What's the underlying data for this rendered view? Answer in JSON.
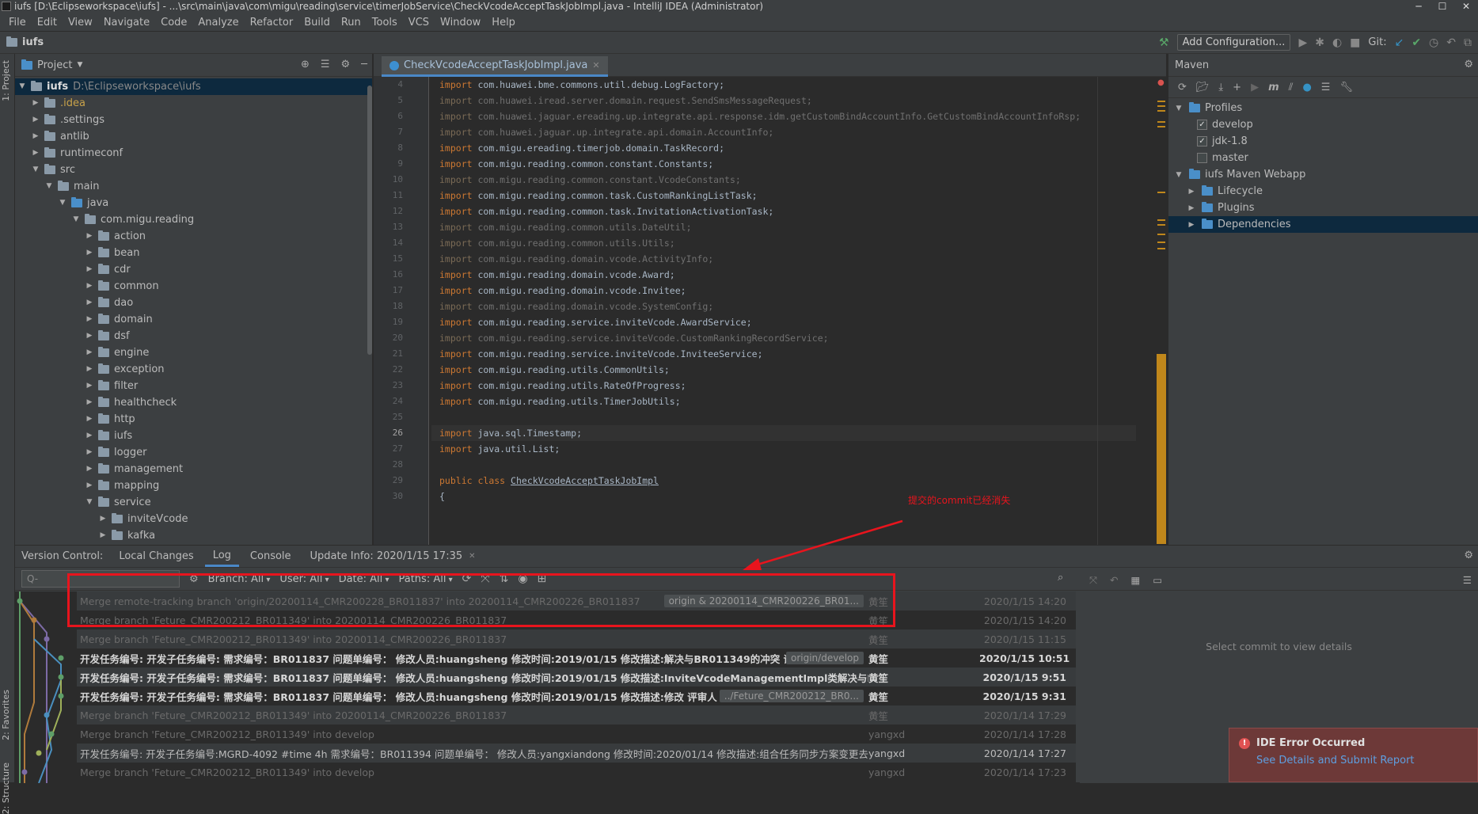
{
  "window": {
    "title": "iufs [D:\\Eclipseworkspace\\iufs] - ...\\src\\main\\java\\com\\migu\\reading\\service\\timerJobService\\CheckVcodeAcceptTaskJobImpl.java - IntelliJ IDEA (Administrator)"
  },
  "menu": [
    "File",
    "Edit",
    "View",
    "Navigate",
    "Code",
    "Analyze",
    "Refactor",
    "Build",
    "Run",
    "Tools",
    "VCS",
    "Window",
    "Help"
  ],
  "nav": {
    "project": "iufs",
    "add_config": "Add Configuration...",
    "git_label": "Git:"
  },
  "side_tabs": {
    "project": "1: Project",
    "favorites": "2: Favorites",
    "structure": "2: Structure"
  },
  "project": {
    "title": "Project",
    "root": {
      "name": "iufs",
      "path": "D:\\Eclipseworkspace\\iufs"
    },
    "tree": [
      {
        "label": ".idea",
        "depth": 1
      },
      {
        "label": ".settings",
        "depth": 1
      },
      {
        "label": "antlib",
        "depth": 1
      },
      {
        "label": "runtimeconf",
        "depth": 1
      },
      {
        "label": "src",
        "depth": 1,
        "open": true
      },
      {
        "label": "main",
        "depth": 2,
        "open": true
      },
      {
        "label": "java",
        "depth": 3,
        "open": true,
        "blue": true
      },
      {
        "label": "com.migu.reading",
        "depth": 4,
        "open": true
      },
      {
        "label": "action",
        "depth": 5
      },
      {
        "label": "bean",
        "depth": 5
      },
      {
        "label": "cdr",
        "depth": 5
      },
      {
        "label": "common",
        "depth": 5
      },
      {
        "label": "dao",
        "depth": 5
      },
      {
        "label": "domain",
        "depth": 5
      },
      {
        "label": "dsf",
        "depth": 5
      },
      {
        "label": "engine",
        "depth": 5
      },
      {
        "label": "exception",
        "depth": 5
      },
      {
        "label": "filter",
        "depth": 5
      },
      {
        "label": "healthcheck",
        "depth": 5
      },
      {
        "label": "http",
        "depth": 5
      },
      {
        "label": "iufs",
        "depth": 5
      },
      {
        "label": "logger",
        "depth": 5
      },
      {
        "label": "management",
        "depth": 5
      },
      {
        "label": "mapping",
        "depth": 5
      },
      {
        "label": "service",
        "depth": 5,
        "open": true
      },
      {
        "label": "inviteVcode",
        "depth": 6
      },
      {
        "label": "kafka",
        "depth": 6
      }
    ]
  },
  "editor": {
    "tab": "CheckVcodeAcceptTaskJobImpl.java",
    "lines": [
      {
        "n": "4",
        "t": "import com.huawei.bme.commons.util.debug.LogFactory;",
        "dim": false
      },
      {
        "n": "5",
        "t": "import com.huawei.iread.server.domain.request.SendSmsMessageRequest;",
        "dim": true
      },
      {
        "n": "6",
        "t": "import com.huawei.jaguar.ereading.up.integrate.api.response.idm.getCustomBindAccountInfo.GetCustomBindAccountInfoRsp;",
        "dim": true
      },
      {
        "n": "7",
        "t": "import com.huawei.jaguar.up.integrate.api.domain.AccountInfo;",
        "dim": true
      },
      {
        "n": "8",
        "t": "import com.migu.ereading.timerjob.domain.TaskRecord;",
        "dim": false
      },
      {
        "n": "9",
        "t": "import com.migu.reading.common.constant.Constants;",
        "dim": false
      },
      {
        "n": "10",
        "t": "import com.migu.reading.common.constant.VcodeConstants;",
        "dim": true
      },
      {
        "n": "11",
        "t": "import com.migu.reading.common.task.CustomRankingListTask;",
        "dim": false
      },
      {
        "n": "12",
        "t": "import com.migu.reading.common.task.InvitationActivationTask;",
        "dim": false
      },
      {
        "n": "13",
        "t": "import com.migu.reading.common.utils.DateUtil;",
        "dim": true
      },
      {
        "n": "14",
        "t": "import com.migu.reading.common.utils.Utils;",
        "dim": true
      },
      {
        "n": "15",
        "t": "import com.migu.reading.domain.vcode.ActivityInfo;",
        "dim": true
      },
      {
        "n": "16",
        "t": "import com.migu.reading.domain.vcode.Award;",
        "dim": false
      },
      {
        "n": "17",
        "t": "import com.migu.reading.domain.vcode.Invitee;",
        "dim": false
      },
      {
        "n": "18",
        "t": "import com.migu.reading.domain.vcode.SystemConfig;",
        "dim": true
      },
      {
        "n": "19",
        "t": "import com.migu.reading.service.inviteVcode.AwardService;",
        "dim": false
      },
      {
        "n": "20",
        "t": "import com.migu.reading.service.inviteVcode.CustomRankingRecordService;",
        "dim": true
      },
      {
        "n": "21",
        "t": "import com.migu.reading.service.inviteVcode.InviteeService;",
        "dim": false
      },
      {
        "n": "22",
        "t": "import com.migu.reading.utils.CommonUtils;",
        "dim": false
      },
      {
        "n": "23",
        "t": "import com.migu.reading.utils.RateOfProgress;",
        "dim": false
      },
      {
        "n": "24",
        "t": "import com.migu.reading.utils.TimerJobUtils;",
        "dim": false
      },
      {
        "n": "25",
        "t": "",
        "dim": false
      },
      {
        "n": "26",
        "t": "import java.sql.Timestamp;",
        "dim": false,
        "cur": true
      },
      {
        "n": "27",
        "t": "import java.util.List;",
        "dim": false
      },
      {
        "n": "28",
        "t": "",
        "dim": false
      },
      {
        "n": "29",
        "t": "public class CheckVcodeAcceptTaskJobImpl",
        "dim": false,
        "cls": true
      },
      {
        "n": "30",
        "t": "{",
        "dim": false
      }
    ]
  },
  "maven": {
    "title": "Maven",
    "items": [
      {
        "label": "Profiles",
        "depth": 0,
        "open": true
      },
      {
        "label": "develop",
        "depth": 1,
        "check": true
      },
      {
        "label": "jdk-1.8",
        "depth": 1,
        "check": true
      },
      {
        "label": "master",
        "depth": 1,
        "check": false
      },
      {
        "label": "iufs Maven Webapp",
        "depth": 0,
        "open": true
      },
      {
        "label": "Lifecycle",
        "depth": 1
      },
      {
        "label": "Plugins",
        "depth": 1
      },
      {
        "label": "Dependencies",
        "depth": 1,
        "sel": true
      }
    ]
  },
  "vcs": {
    "label": "Version Control:",
    "tabs": [
      "Local Changes",
      "Log",
      "Console",
      "Update Info: 2020/1/15 17:35"
    ],
    "search_placeholder": "Q-",
    "filters": [
      "Branch: All",
      "User: All",
      "Date: All",
      "Paths: All"
    ],
    "details_placeholder": "Select commit to view details",
    "commits": [
      {
        "msg": "Merge remote-tracking branch 'origin/20200114_CMR200228_BR011837' into 20200114_CMR200226_BR011837",
        "tag": "origin & 20200114_CMR200226_BR01...",
        "author": "黄笙",
        "date": "2020/1/15 14:20",
        "style": "grey"
      },
      {
        "msg": "Merge branch 'Feture_CMR200212_BR011349' into 20200114_CMR200226_BR011837",
        "tag": "",
        "author": "黄笙",
        "date": "2020/1/15 14:20",
        "style": "grey"
      },
      {
        "msg": "Merge branch 'Feture_CMR200212_BR011349' into 20200114_CMR200226_BR011837",
        "tag": "",
        "author": "黄笙",
        "date": "2020/1/15 11:15",
        "style": "grey"
      },
      {
        "msg": "开发任务编号: 开发子任务编号: 需求编号：BR011837 问题单编号： 修改人员:huangsheng 修改时间:2019/01/15 修改描述:解决与BR011349的冲突 评审人",
        "tag": "origin/develop",
        "author": "黄笙",
        "date": "2020/1/15 10:51",
        "style": "bold"
      },
      {
        "msg": "开发任务编号: 开发子任务编号: 需求编号：BR011837 问题单编号： 修改人员:huangsheng 修改时间:2019/01/15 修改描述:InviteVcodeManagementImpl类解决与BR011349的冲突",
        "tag": "",
        "author": "黄笙",
        "date": "2020/1/15 9:51",
        "style": "bold"
      },
      {
        "msg": "开发任务编号: 开发子任务编号: 需求编号：BR011837 问题单编号： 修改人员:huangsheng 修改时间:2019/01/15 修改描述:修改 评审人",
        "tag": "../Feture_CMR200212_BR0...",
        "author": "黄笙",
        "date": "2020/1/15 9:31",
        "style": "bold"
      },
      {
        "msg": "Merge branch 'Feture_CMR200212_BR011349' into 20200114_CMR200226_BR011837",
        "tag": "",
        "author": "黄笙",
        "date": "2020/1/14 17:29",
        "style": "grey"
      },
      {
        "msg": "Merge branch 'Feture_CMR200212_BR011349' into develop",
        "tag": "",
        "author": "yangxd",
        "date": "2020/1/14 17:28",
        "style": "grey"
      },
      {
        "msg": "开发任务编号: 开发子任务编号:MGRD-4092 #time 4h 需求编号：BR011394 问题单编号： 修改人员:yangxiandong 修改时间:2020/01/14 修改描述:组合任务同步方案变更去掉多余字段",
        "tag": "",
        "author": "yangxd",
        "date": "2020/1/14 17:27",
        "style": "normal"
      },
      {
        "msg": "Merge branch 'Feture_CMR200212_BR011349' into develop",
        "tag": "",
        "author": "yangxd",
        "date": "2020/1/14 17:23",
        "style": "grey"
      }
    ]
  },
  "annotation": "提交的commit已经消失",
  "notification": {
    "title": "IDE Error Occurred",
    "link": "See Details and Submit Report"
  },
  "colors": {
    "accent": "#4a88c7",
    "annotation_red": "#e8141d",
    "keyword": "#cc7832",
    "warning_stripe": "#c0871b"
  }
}
